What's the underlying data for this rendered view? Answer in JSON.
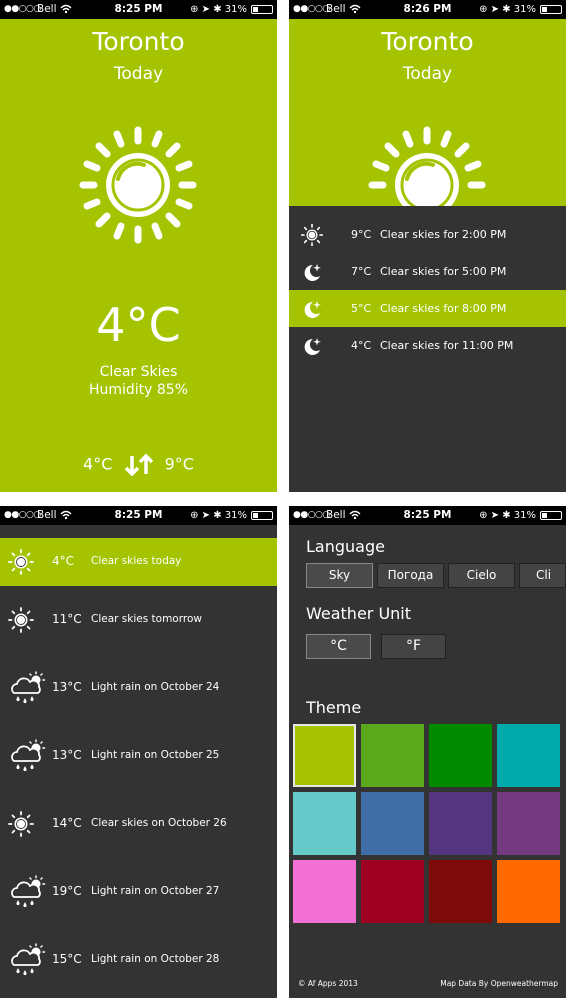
{
  "colors": {
    "accent": "#a5c300",
    "dark": "#333333"
  },
  "status": [
    {
      "carrier": "Bell",
      "time": "8:25 PM",
      "battery": "31%"
    },
    {
      "carrier": "Bell",
      "time": "8:26 PM",
      "battery": "31%"
    },
    {
      "carrier": "Bell",
      "time": "8:25 PM",
      "battery": "31%"
    },
    {
      "carrier": "Bell",
      "time": "8:25 PM",
      "battery": "31%"
    }
  ],
  "today": {
    "city": "Toronto",
    "day": "Today",
    "icon": "sun-icon",
    "temp": "4°C",
    "condition": "Clear Skies",
    "humidity": "Humidity 85%",
    "low": "4°C",
    "high": "9°C"
  },
  "hourly": {
    "city": "Toronto",
    "day": "Today",
    "items": [
      {
        "icon": "sun-icon",
        "temp": "9°C",
        "desc": "Clear skies for 2:00 PM"
      },
      {
        "icon": "moon-icon",
        "temp": "7°C",
        "desc": "Clear skies for 5:00 PM"
      },
      {
        "icon": "moon-icon",
        "temp": "5°C",
        "desc": "Clear skies for 8:00 PM"
      },
      {
        "icon": "moon-icon",
        "temp": "4°C",
        "desc": "Clear skies for 11:00 PM"
      }
    ]
  },
  "daily": [
    {
      "icon": "sun-icon",
      "temp": "4°C",
      "desc": "Clear skies today"
    },
    {
      "icon": "sun-icon",
      "temp": "11°C",
      "desc": "Clear skies tomorrow"
    },
    {
      "icon": "rain-icon",
      "temp": "13°C",
      "desc": "Light rain on October 24"
    },
    {
      "icon": "rain-icon",
      "temp": "13°C",
      "desc": "Light rain on October 25"
    },
    {
      "icon": "sun-icon",
      "temp": "14°C",
      "desc": "Clear skies on October 26"
    },
    {
      "icon": "rain-icon",
      "temp": "19°C",
      "desc": "Light rain on October 27"
    },
    {
      "icon": "rain-icon",
      "temp": "15°C",
      "desc": "Light rain on October 28"
    }
  ],
  "settings": {
    "language_title": "Language",
    "languages": [
      "Sky",
      "Погода",
      "Cielo",
      "Cli"
    ],
    "selected_language": "Sky",
    "unit_title": "Weather Unit",
    "units": [
      "°C",
      "°F"
    ],
    "selected_unit": "°C",
    "theme_title": "Theme",
    "themes": [
      "#a5c300",
      "#5ca81c",
      "#008a00",
      "#00aaaa",
      "#66c9c9",
      "#3f6ea6",
      "#54367e",
      "#743a80",
      "#f26fd3",
      "#a00021",
      "#7f0a0a",
      "#ff6a00"
    ],
    "selected_theme": "#a5c300",
    "footer_left": "© Af Apps 2013",
    "footer_right": "Map Data By Openweathermap"
  }
}
